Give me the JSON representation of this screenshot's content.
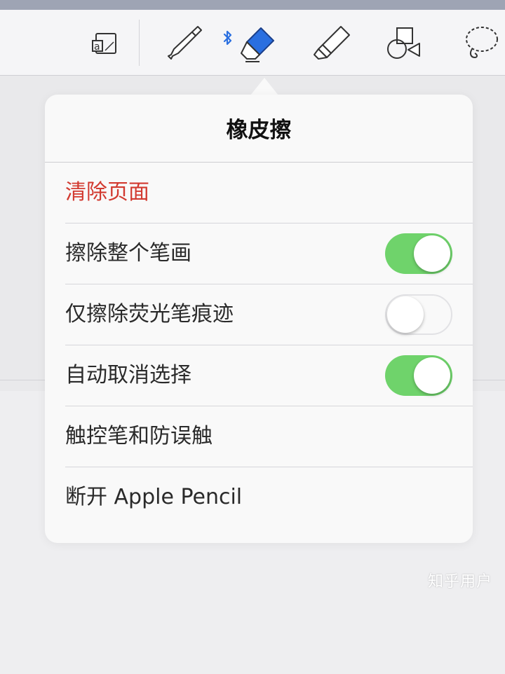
{
  "toolbar": {
    "tools": [
      {
        "icon": "text-frame-icon"
      },
      {
        "icon": "pen-icon"
      },
      {
        "icon": "eraser-icon",
        "selected": true,
        "connected_icon": "bluetooth-icon"
      },
      {
        "icon": "highlighter-icon"
      },
      {
        "icon": "shapes-icon"
      },
      {
        "icon": "lasso-icon"
      }
    ],
    "accent_color": "#2a6fe0"
  },
  "popover": {
    "title": "橡皮擦",
    "rows": [
      {
        "label": "清除页面",
        "type": "action",
        "destructive": true
      },
      {
        "label": "擦除整个笔画",
        "type": "toggle",
        "on": true
      },
      {
        "label": "仅擦除荧光笔痕迹",
        "type": "toggle",
        "on": false
      },
      {
        "label": "自动取消选择",
        "type": "toggle",
        "on": true
      },
      {
        "label": "触控笔和防误触",
        "type": "navigation"
      },
      {
        "label": "断开 Apple Pencil",
        "type": "action"
      }
    ],
    "colors": {
      "destructive": "#d23a30",
      "toggle_on": "#6fd36b"
    }
  },
  "watermark": "知乎用户"
}
